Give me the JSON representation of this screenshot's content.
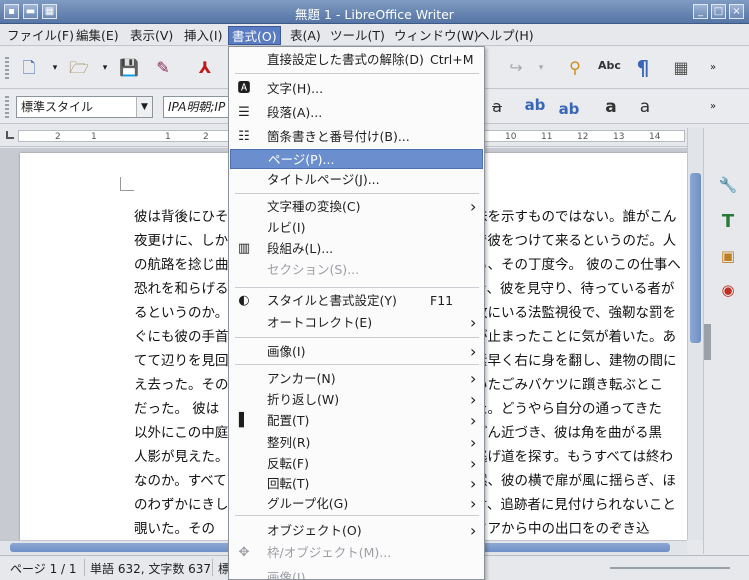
{
  "window": {
    "title": "無題 1 - LibreOffice Writer"
  },
  "menubar": {
    "items": [
      "ファイル(F)",
      "編集(E)",
      "表示(V)",
      "挿入(I)",
      "書式(O)",
      "表(A)",
      "ツール(T)",
      "ウィンドウ(W)",
      "ヘルプ(H)"
    ]
  },
  "formatbar": {
    "style_value": "標準スタイル",
    "font_value": "IPA明朝;IP"
  },
  "ruler": {
    "ticks": [
      "2",
      "1",
      "",
      "1",
      "2",
      "3",
      "4",
      "5",
      "6",
      "7",
      "8",
      "9",
      "10",
      "11",
      "12",
      "13",
      "14",
      "15",
      "16",
      "17",
      "18"
    ]
  },
  "document": {
    "lines": [
      "彼は背後にひそ",
      "夜更けに、しか",
      "の航路を捻じ曲",
      "恐れを和らげる",
      "るというのか。",
      "ぐにも彼の手首",
      "てて辺りを見回",
      "え去った。その",
      "だった。 彼は",
      "以外にこの中庭",
      "人影が見えた。",
      "なのか。すべて",
      "のわずかにきし",
      "覗いた。その"
    ],
    "right_lines": [
      "味を示すものではない。誰がこん",
      "で彼をつけて来るというのだ。人",
      "る、その丁度今。 彼のこの仕事へ",
      "き、彼を見守り、待っている者が",
      "敗にいる法監視役で、強靭な罰を",
      "が止まったことに気が着いた。あ",
      "素早く右に身を翻し、建物の間に",
      "いたごみバケツに躓き転ぶとこ",
      "た。どうやら自分の通ってきた",
      "どん近づき、彼は角を曲がる黒",
      "逃げ道を探す。もうすべては終わ",
      "然、彼の横で扉が風に揺らぎ、ほ",
      "け、追跡者に見付けられないこと",
      "ドアから中の出口をのぞき込"
    ]
  },
  "format_menu": {
    "items": [
      {
        "label": "直接設定した書式の解除(D)",
        "accel": "Ctrl+M"
      },
      {
        "label": "文字(H)..."
      },
      {
        "label": "段落(A)..."
      },
      {
        "label": "箇条書きと番号付け(B)..."
      },
      {
        "label": "ページ(P)..."
      },
      {
        "label": "タイトルページ(J)..."
      },
      {
        "label": "文字種の変換(C)"
      },
      {
        "label": "ルビ(I)"
      },
      {
        "label": "段組み(L)..."
      },
      {
        "label": "セクション(S)..."
      },
      {
        "label": "スタイルと書式設定(Y)",
        "accel": "F11"
      },
      {
        "label": "オートコレクト(E)"
      },
      {
        "label": "画像(I)"
      },
      {
        "label": "アンカー(N)"
      },
      {
        "label": "折り返し(W)"
      },
      {
        "label": "配置(T)"
      },
      {
        "label": "整列(R)"
      },
      {
        "label": "反転(F)"
      },
      {
        "label": "回転(T)"
      },
      {
        "label": "グループ化(G)"
      },
      {
        "label": "オブジェクト(O)"
      },
      {
        "label": "枠/オブジェクト(M)..."
      },
      {
        "label": "画像(I)..."
      }
    ]
  },
  "statusbar": {
    "page": "ページ 1 / 1",
    "words": "単語 632, 文字数 637",
    "more": "標"
  },
  "colors": {
    "accent": "#6b8fce",
    "titlebar": "#6a87b6"
  }
}
